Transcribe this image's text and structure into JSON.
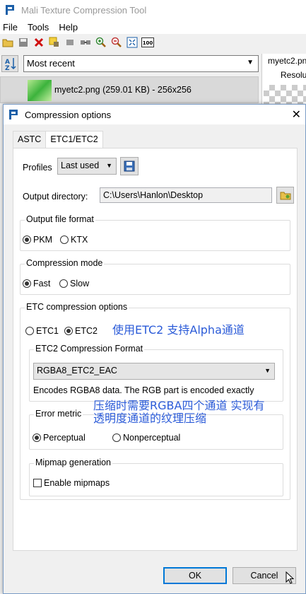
{
  "app": {
    "title": "Mali Texture Compression Tool",
    "menu": [
      "File",
      "Tools",
      "Help"
    ],
    "recent_select": "Most recent",
    "file_row": "myetc2.png (259.01 KB) - 256x256",
    "right_panel_file": "myetc2.pn",
    "right_panel_label": "Resolu"
  },
  "dialog": {
    "title": "Compression options",
    "tabs": [
      "ASTC",
      "ETC1/ETC2"
    ],
    "active_tab": "ETC1/ETC2",
    "profiles_label": "Profiles",
    "profiles_value": "Last used",
    "output_dir_label": "Output directory:",
    "output_dir_value": "C:\\Users\\Hanlon\\Desktop",
    "output_format": {
      "title": "Output file format",
      "options": [
        "PKM",
        "KTX"
      ],
      "selected": "PKM"
    },
    "compression_mode": {
      "title": "Compression mode",
      "options": [
        "Fast",
        "Slow"
      ],
      "selected": "Fast"
    },
    "etc_options": {
      "title": "ETC compression options",
      "options": [
        "ETC1",
        "ETC2"
      ],
      "selected": "ETC2",
      "etc2_format": {
        "title": "ETC2 Compression Format",
        "value": "RGBA8_ETC2_EAC",
        "description": "Encodes RGBA8 data. The RGB part is encoded exactly"
      },
      "error_metric": {
        "title": "Error metric",
        "options": [
          "Perceptual",
          "Nonperceptual"
        ],
        "selected": "Perceptual"
      },
      "mipmap": {
        "title": "Mipmap generation",
        "checkbox_label": "Enable mipmaps",
        "checked": false
      }
    },
    "ok_label": "OK",
    "cancel_label": "Cancel"
  },
  "annotations": {
    "note1": "使用ETC2 支持Alpha通道",
    "note2_line1": "压缩时需要RGBA四个通道 实现有",
    "note2_line2": "透明度通道的纹理压缩"
  },
  "colors": {
    "annotation": "#2b5bd8",
    "primary_button_border": "#0078d7"
  }
}
